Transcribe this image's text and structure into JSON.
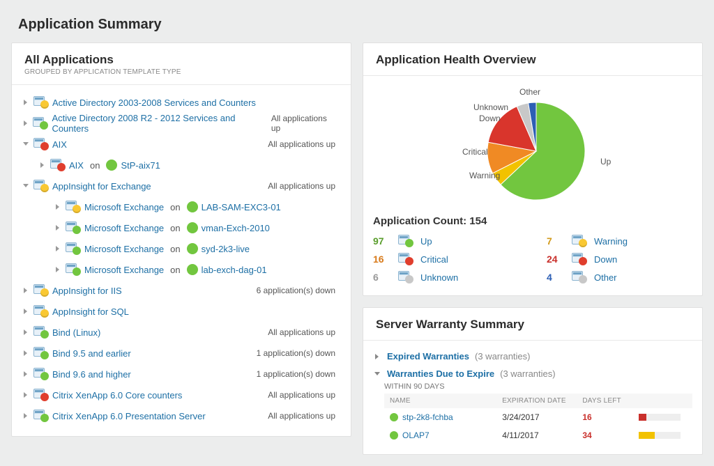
{
  "pageTitle": "Application Summary",
  "allApps": {
    "title": "All Applications",
    "subtitle": "GROUPED BY APPLICATION TEMPLATE TYPE",
    "onWord": "on",
    "rows": [
      {
        "type": "group",
        "indent": 0,
        "expanded": false,
        "badge": "warn",
        "label": "Active Directory 2003-2008 Services and Counters",
        "status": ""
      },
      {
        "type": "group",
        "indent": 0,
        "expanded": false,
        "badge": "up",
        "label": "Active Directory 2008 R2 - 2012 Services and Counters",
        "status": "All applications up"
      },
      {
        "type": "group",
        "indent": 0,
        "expanded": true,
        "badge": "crit",
        "label": "AIX",
        "status": "All applications up"
      },
      {
        "type": "app",
        "indent": 1,
        "appBadge": "crit",
        "appLabel": "AIX",
        "nodeBadge": "up",
        "nodeLabel": "StP-aix71"
      },
      {
        "type": "group",
        "indent": 0,
        "expanded": true,
        "badge": "warn",
        "label": "AppInsight for Exchange",
        "status": "All applications up"
      },
      {
        "type": "app",
        "indent": 2,
        "appBadge": "warn",
        "appLabel": "Microsoft Exchange",
        "nodeBadge": "up",
        "nodeLabel": "LAB-SAM-EXC3-01"
      },
      {
        "type": "app",
        "indent": 2,
        "appBadge": "up",
        "appLabel": "Microsoft Exchange",
        "nodeBadge": "up",
        "nodeLabel": "vman-Exch-2010"
      },
      {
        "type": "app",
        "indent": 2,
        "appBadge": "up",
        "appLabel": "Microsoft Exchange",
        "nodeBadge": "up",
        "nodeLabel": "syd-2k3-live"
      },
      {
        "type": "app",
        "indent": 2,
        "appBadge": "up",
        "appLabel": "Microsoft Exchange",
        "nodeBadge": "up",
        "nodeLabel": "lab-exch-dag-01"
      },
      {
        "type": "group",
        "indent": 0,
        "expanded": false,
        "badge": "warn",
        "label": "AppInsight for IIS",
        "status": "6 application(s) down"
      },
      {
        "type": "group",
        "indent": 0,
        "expanded": false,
        "badge": "warn",
        "label": "AppInsight for SQL",
        "status": ""
      },
      {
        "type": "group",
        "indent": 0,
        "expanded": false,
        "badge": "up",
        "label": "Bind (Linux)",
        "status": "All applications up"
      },
      {
        "type": "group",
        "indent": 0,
        "expanded": false,
        "badge": "up",
        "label": "Bind 9.5 and earlier",
        "status": "1 application(s) down"
      },
      {
        "type": "group",
        "indent": 0,
        "expanded": false,
        "badge": "up",
        "label": "Bind 9.6 and higher",
        "status": "1 application(s) down"
      },
      {
        "type": "group",
        "indent": 0,
        "expanded": false,
        "badge": "crit",
        "label": "Citrix XenApp 6.0 Core counters",
        "status": "All applications up"
      },
      {
        "type": "group",
        "indent": 0,
        "expanded": false,
        "badge": "up",
        "label": "Citrix XenApp 6.0 Presentation Server",
        "status": "All applications up"
      }
    ]
  },
  "health": {
    "title": "Application Health Overview",
    "countLabel": "Application Count: 154",
    "pieLabels": {
      "other": "Other",
      "unknown": "Unknown",
      "down": "Down",
      "critical": "Critical",
      "warning": "Warning",
      "up": "Up"
    },
    "legend": [
      {
        "num": "97",
        "cls": "n-green",
        "badge": "up",
        "label": "Up"
      },
      {
        "num": "16",
        "cls": "n-orange",
        "badge": "crit",
        "label": "Critical"
      },
      {
        "num": "6",
        "cls": "n-grey",
        "badge": "grey",
        "label": "Unknown"
      },
      {
        "num": "7",
        "cls": "n-yorange",
        "badge": "warn",
        "label": "Warning"
      },
      {
        "num": "24",
        "cls": "n-red",
        "badge": "down",
        "label": "Down"
      },
      {
        "num": "4",
        "cls": "n-blue",
        "badge": "grey",
        "label": "Other"
      }
    ]
  },
  "warranty": {
    "title": "Server Warranty Summary",
    "expired": {
      "label": "Expired Warranties",
      "count": "(3 warranties)"
    },
    "due": {
      "label": "Warranties Due to Expire",
      "count": "(3 warranties)",
      "within": "WITHIN 90 DAYS"
    },
    "cols": {
      "name": "NAME",
      "exp": "EXPIRATION DATE",
      "days": "DAYS LEFT"
    },
    "rows": [
      {
        "badge": "up",
        "name": "stp-2k8-fchba",
        "date": "3/24/2017",
        "days": "16",
        "pct": 18,
        "color": "#c9302c"
      },
      {
        "badge": "up",
        "name": "OLAP7",
        "date": "4/11/2017",
        "days": "34",
        "pct": 38,
        "color": "#f2c200"
      }
    ]
  },
  "chart_data": {
    "type": "pie",
    "title": "Application Health Overview",
    "series": [
      {
        "name": "Up",
        "value": 97,
        "color": "#72c63f"
      },
      {
        "name": "Warning",
        "value": 7,
        "color": "#f2c200"
      },
      {
        "name": "Critical",
        "value": 16,
        "color": "#f08a24"
      },
      {
        "name": "Down",
        "value": 24,
        "color": "#d9352c"
      },
      {
        "name": "Unknown",
        "value": 6,
        "color": "#c8c8c8"
      },
      {
        "name": "Other",
        "value": 4,
        "color": "#2d5fb5"
      }
    ],
    "total": 154
  }
}
